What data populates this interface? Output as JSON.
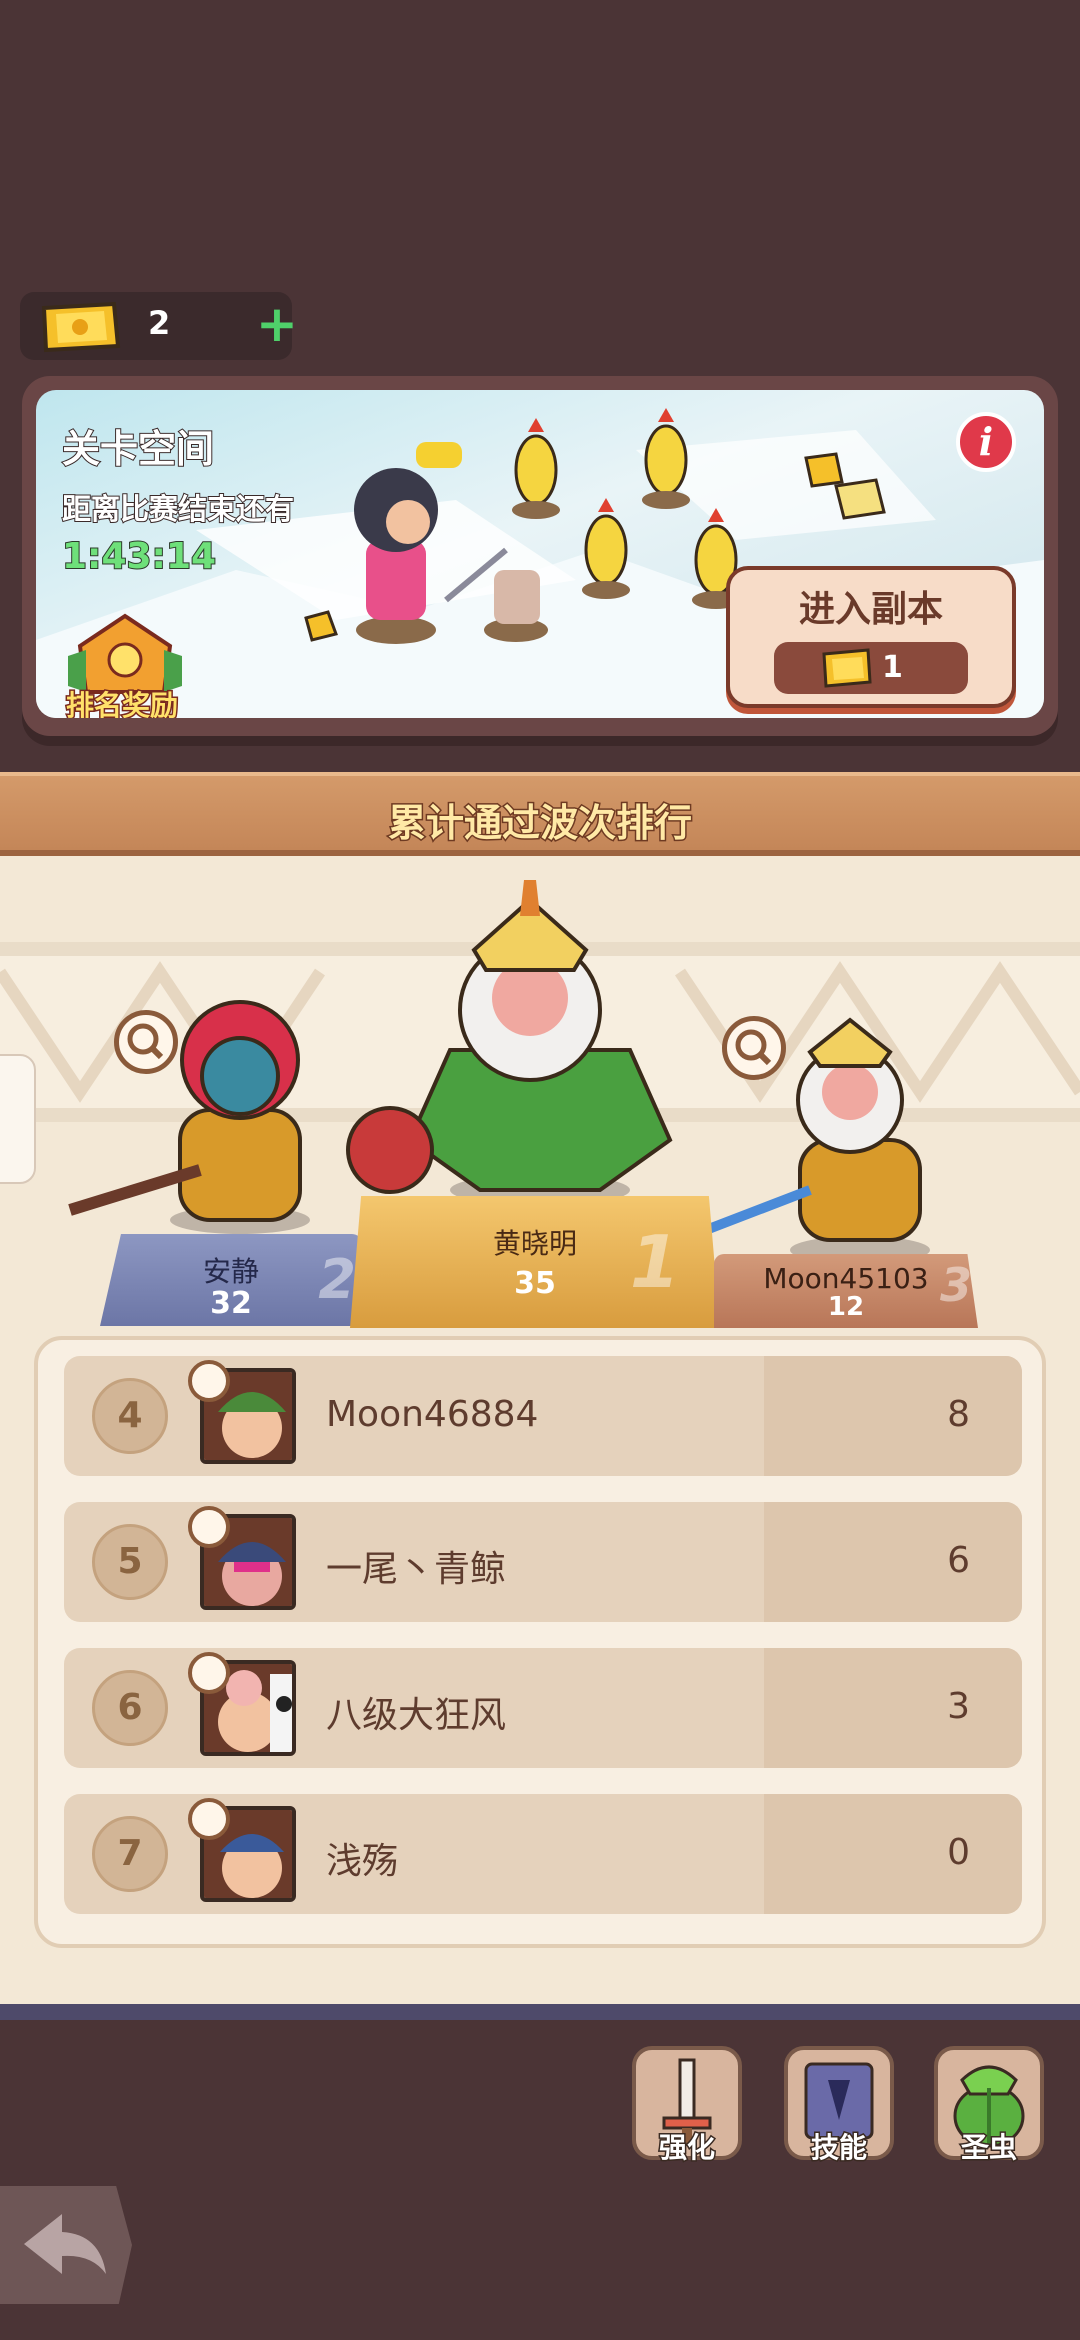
{
  "tickets": {
    "count": "2",
    "plus": "+"
  },
  "level": {
    "title": "关卡空间",
    "countdown_label": "距离比赛结束还有",
    "timer": "1:43:14",
    "rank_reward": "排名奖励",
    "info": "i",
    "enter_label": "进入副本",
    "enter_cost": "1"
  },
  "ranking": {
    "title": "累计通过波次排行",
    "podium": [
      {
        "place": "1",
        "name": "黄晓明",
        "score": "35"
      },
      {
        "place": "2",
        "name": "安静",
        "score": "32"
      },
      {
        "place": "3",
        "name": "Moon45103",
        "score": "12"
      }
    ],
    "list": [
      {
        "rank": "4",
        "name": "Moon46884",
        "score": "8",
        "color": "#4a8a3a"
      },
      {
        "rank": "5",
        "name": "一尾丶青鲸",
        "score": "6",
        "color": "#3a4a7a"
      },
      {
        "rank": "6",
        "name": "八级大狂风",
        "score": "3",
        "color": "#f2b4b0"
      },
      {
        "rank": "7",
        "name": "浅殇",
        "score": "0",
        "color": "#3a5a9a"
      }
    ]
  },
  "tools": [
    {
      "label": "强化",
      "icon": "sword-icon"
    },
    {
      "label": "技能",
      "icon": "skill-book-icon"
    },
    {
      "label": "圣虫",
      "icon": "holy-bug-icon"
    }
  ],
  "colors": {
    "background": "#4b3436",
    "panel": "#f3e8d6",
    "timer": "#6ee07a",
    "header_text": "#ffe9a6"
  }
}
